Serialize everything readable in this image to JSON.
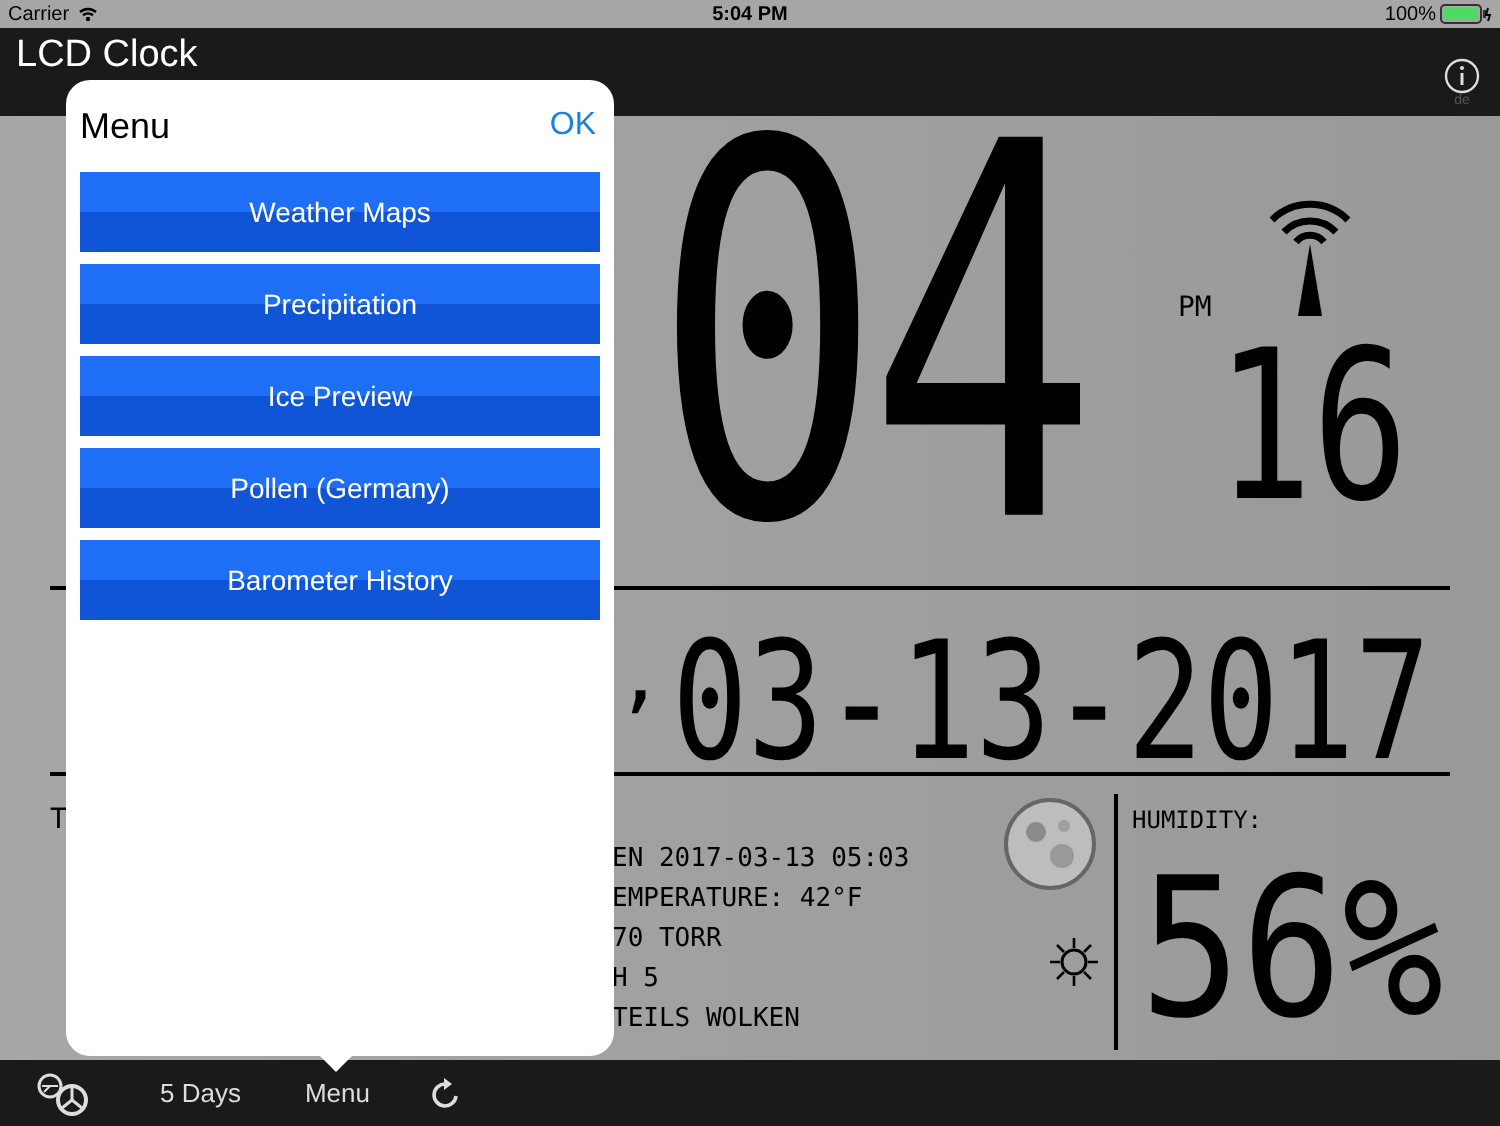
{
  "status_bar": {
    "carrier": "Carrier",
    "time": "5:04 PM",
    "battery": "100%"
  },
  "nav": {
    "title": "LCD Clock",
    "info_caption": "de"
  },
  "clock": {
    "hours_minutes": "04",
    "ampm": "PM",
    "seconds": "16",
    "date_separator": ",",
    "date": "03-13-2017"
  },
  "weather": {
    "left_label": "T",
    "lines": [
      "EN 2017-03-13 05:03",
      "EMPERATURE: 42°F",
      "70 TORR",
      "H 5",
      "TEILS WOLKEN"
    ]
  },
  "humidity": {
    "label": "HUMIDITY:",
    "value": "56%"
  },
  "popover": {
    "title": "Menu",
    "confirm": "OK",
    "items": [
      "Weather Maps",
      "Precipitation",
      "Ice Preview",
      "Pollen (Germany)",
      "Barometer History"
    ]
  },
  "toolbar": {
    "forecast": "5 Days",
    "menu": "Menu"
  }
}
